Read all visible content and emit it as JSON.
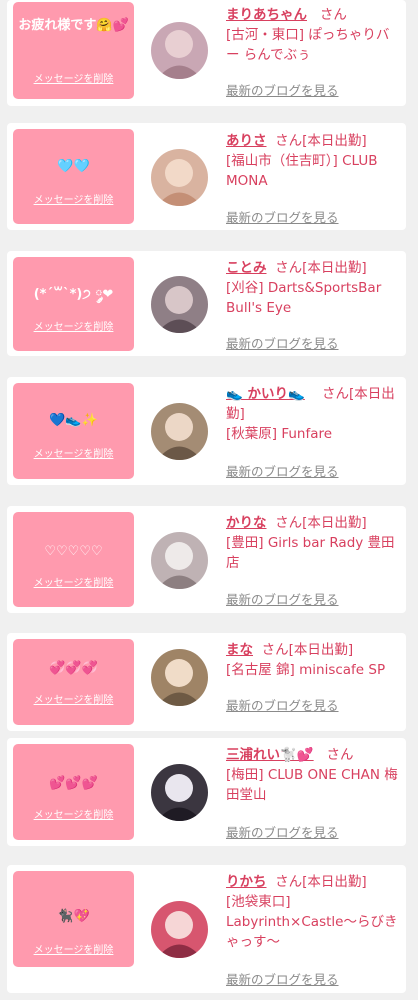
{
  "cards": [
    {
      "msg": "お疲れ様です🤗💕",
      "delete": "メッセージを削除",
      "name": "まりあちゃん",
      "suffix": "さん",
      "shop": "[古河・東口] ぽっちゃりバー らんでぶぅ",
      "blog": "最新のブログを見る",
      "avatar_color": "#c9a7b4"
    },
    {
      "msg": "🩵🩵",
      "delete": "メッセージを削除",
      "name": "ありさ",
      "suffix": "さん[本日出勤]",
      "shop": "[福山市（住吉町）] CLUB MONA",
      "blog": "最新のブログを見る",
      "avatar_color": "#d9b3a0"
    },
    {
      "msg": "(*´꒳`*)੭ ༘❤",
      "delete": "メッセージを削除",
      "name": "ことみ",
      "suffix": "さん[本日出勤]",
      "shop": "[刈谷] Darts&SportsBar Bull's Eye",
      "blog": "最新のブログを見る",
      "avatar_color": "#8f7f86"
    },
    {
      "msg": "💙👟✨",
      "delete": "メッセージを削除",
      "name": "👟 かいり👟",
      "suffix": "さん[本日出勤]",
      "shop": "[秋葉原] Funfare",
      "blog": "最新のブログを見る",
      "avatar_color": "#a48c74"
    },
    {
      "msg": "♡♡♡♡♡",
      "delete": "メッセージを削除",
      "name": "かりな",
      "suffix": "さん[本日出勤]",
      "shop": "[豊田] Girls bar Rady 豊田店",
      "blog": "最新のブログを見る",
      "avatar_color": "#bfb2b4"
    },
    {
      "msg": "💞💞💞",
      "delete": "メッセージを削除",
      "name": "まな",
      "suffix": "さん[本日出勤]",
      "shop": "[名古屋 錦] miniscafe SP",
      "blog": "最新のブログを見る",
      "avatar_color": "#9f8466"
    },
    {
      "msg": "💕💕💕",
      "delete": "メッセージを削除",
      "name": "三浦れい🐩💕",
      "suffix": "さん",
      "shop": "[梅田] CLUB ONE CHAN 梅田堂山",
      "blog": "最新のブログを見る",
      "avatar_color": "#3b3640"
    },
    {
      "msg": "🐈‍⬛💖",
      "delete": "メッセージを削除",
      "name": "りかち",
      "suffix": "さん[本日出勤]",
      "shop": "[池袋東口] Labyrinth×Castle～らびきゃっす～",
      "blog": "最新のブログを見る",
      "avatar_color": "#d7566f"
    }
  ]
}
